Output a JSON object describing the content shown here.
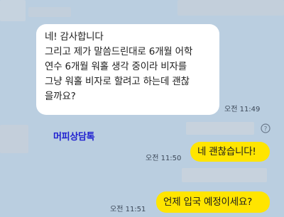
{
  "messages": {
    "incoming": {
      "lines": [
        "네! 감사합니다",
        "그리고 제가 말씀드린대로 6개월 어학",
        "연수 6개월 워홀 생각 중이라 비자를",
        "그냥 워홀 비자로 할려고 하는데 괜찮",
        "을까요?"
      ],
      "time": "오전 11:49"
    },
    "sender_name": "머피상담톡",
    "help_icon": "question-circle-icon",
    "outgoing": [
      {
        "text": "네 괜찮습니다!",
        "time": "오전 11:50"
      },
      {
        "text": "언제 입국 예정이세요?",
        "time": "오전 11:51"
      }
    ]
  },
  "colors": {
    "background": "#bacee0",
    "incoming_bubble": "#ffffff",
    "outgoing_bubble": "#ffe500",
    "sender_name": "#1f1fd0"
  }
}
